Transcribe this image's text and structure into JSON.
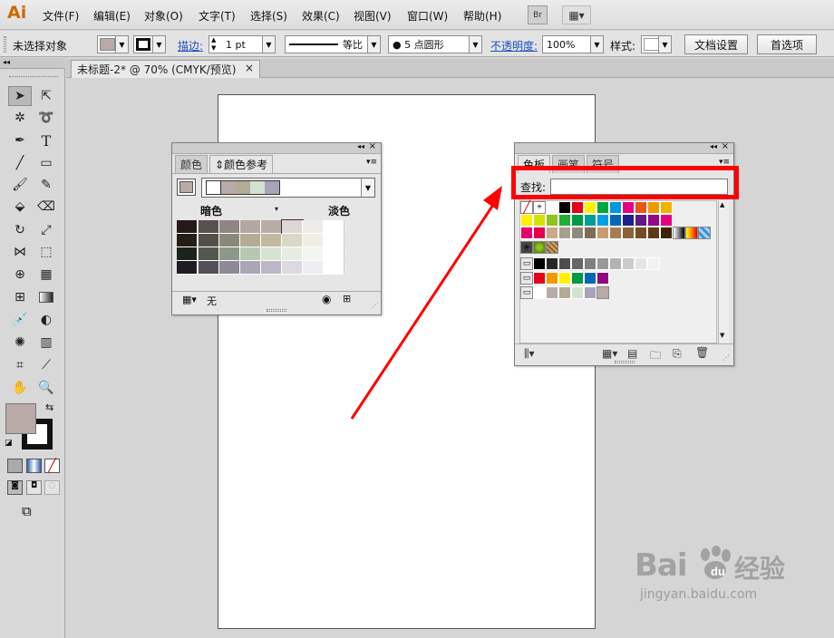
{
  "app": {
    "logo": "Ai"
  },
  "menus": [
    "文件(F)",
    "编辑(E)",
    "对象(O)",
    "文字(T)",
    "选择(S)",
    "效果(C)",
    "视图(V)",
    "窗口(W)",
    "帮助(H)"
  ],
  "menubar_buttons": {
    "bridge": "Br",
    "workspace": "▦▾"
  },
  "controlbar": {
    "selection_label": "未选择对象",
    "stroke_label": "描边:",
    "stroke_weight": "1 pt",
    "stroke_profile": "等比",
    "brush": "● 5 点圆形",
    "opacity_label": "不透明度:",
    "opacity_value": "100%",
    "style_label": "样式:",
    "doc_setup": "文档设置",
    "preferences": "首选项"
  },
  "document_tab": {
    "title": "未标题-2* @ 70% (CMYK/预览)",
    "close": "×"
  },
  "color_guide_panel": {
    "tabs": [
      "颜色",
      "⇕颜色参考"
    ],
    "darker_label": "暗色",
    "lighter_label": "淡色",
    "footer_label": "无",
    "harmony_colors": [
      "#ffffff",
      "#b9aaa7",
      "#b2ab95",
      "#d3e2d0",
      "#a8a3b8"
    ],
    "grid_colors": [
      [
        "#241a19",
        "#57514f",
        "#8e8584",
        "#b3a7a4",
        "#b8aca9",
        "#ddd6d5",
        "#efebea",
        "#ffffff"
      ],
      [
        "#231e17",
        "#53504a",
        "#8c8879",
        "#b3ab93",
        "#c0b99f",
        "#dbd7c6",
        "#efede4",
        "#ffffff"
      ],
      [
        "#1c221c",
        "#52574f",
        "#8d9889",
        "#b7c8b2",
        "#d6e3d0",
        "#e5ece2",
        "#f2f5f0",
        "#ffffff"
      ],
      [
        "#1e1c23",
        "#535057",
        "#8d8997",
        "#aaa5b7",
        "#bcb7c7",
        "#dcd9e1",
        "#eeedf1",
        "#ffffff"
      ]
    ]
  },
  "swatches_panel": {
    "tabs": [
      "色板",
      "画笔",
      "符号"
    ],
    "search_label": "查找:",
    "search_value": "",
    "row1": [
      "#ffffff",
      "#000000",
      "#e4001a",
      "#fff100",
      "#00a73c",
      "#0097dc",
      "#e4007f",
      "#e95513",
      "#f39800",
      "#f6b000"
    ],
    "row2": [
      "#fff100",
      "#d5e100",
      "#8fc31f",
      "#22ac38",
      "#009944",
      "#009e96",
      "#00a0e9",
      "#0068b7",
      "#1d2088",
      "#601986",
      "#920783",
      "#e4007f"
    ],
    "row3": [
      "#e4006e",
      "#e5004f",
      "#c9ab89",
      "#a59f8d",
      "#8f8a7d",
      "#7f6c58",
      "#c69c6d",
      "#a67c52",
      "#8c6239",
      "#754c24",
      "#603913",
      "#42210b"
    ],
    "gray_row": [
      "#000000",
      "#262626",
      "#4d4d4d",
      "#666666",
      "#808080",
      "#999999",
      "#b3b3b3",
      "#cccccc",
      "#e6e6e6",
      "#f2f2f2"
    ],
    "bright_row": [
      "#e4001a",
      "#f39800",
      "#fff100",
      "#009944",
      "#0068b7",
      "#920783"
    ],
    "guide_row": [
      "#ffffff",
      "#b9aaa7",
      "#b2ab95",
      "#d3e2d0",
      "#a8a3b8"
    ]
  },
  "watermark": {
    "brand": "Bai",
    "brand2": "经验",
    "url": "jingyan.baidu.com"
  },
  "colors": {
    "highlight": "#ff0000",
    "fill": "#b9aaa7"
  }
}
